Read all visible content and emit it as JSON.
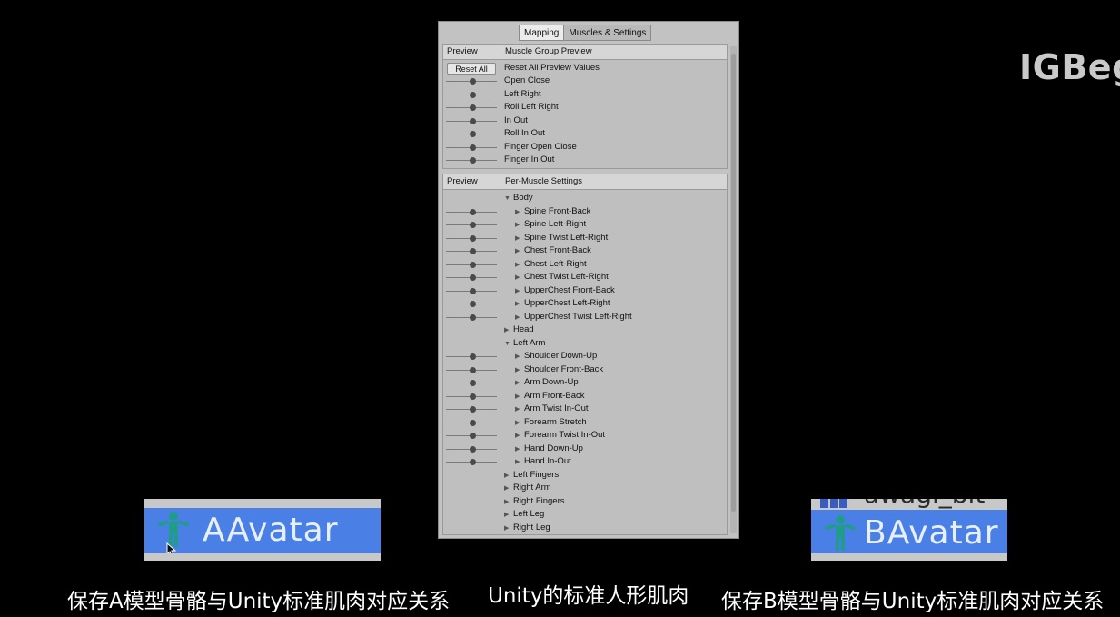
{
  "watermark": "IGBeg",
  "tabs": {
    "mapping": "Mapping",
    "muscles": "Muscles & Settings"
  },
  "muscle_group": {
    "col_preview": "Preview",
    "col_title": "Muscle Group Preview",
    "reset_button": "Reset All",
    "reset_label": "Reset All Preview Values",
    "items": [
      "Open Close",
      "Left Right",
      "Roll Left Right",
      "In Out",
      "Roll In Out",
      "Finger Open Close",
      "Finger In Out"
    ]
  },
  "per_muscle": {
    "col_preview": "Preview",
    "col_title": "Per-Muscle Settings",
    "rows": [
      {
        "label": "Body",
        "level": 0,
        "expanded": true,
        "slider": false
      },
      {
        "label": "Spine Front-Back",
        "level": 1,
        "expanded": false,
        "slider": true
      },
      {
        "label": "Spine Left-Right",
        "level": 1,
        "expanded": false,
        "slider": true
      },
      {
        "label": "Spine Twist Left-Right",
        "level": 1,
        "expanded": false,
        "slider": true
      },
      {
        "label": "Chest Front-Back",
        "level": 1,
        "expanded": false,
        "slider": true
      },
      {
        "label": "Chest Left-Right",
        "level": 1,
        "expanded": false,
        "slider": true
      },
      {
        "label": "Chest Twist Left-Right",
        "level": 1,
        "expanded": false,
        "slider": true
      },
      {
        "label": "UpperChest Front-Back",
        "level": 1,
        "expanded": false,
        "slider": true
      },
      {
        "label": "UpperChest Left-Right",
        "level": 1,
        "expanded": false,
        "slider": true
      },
      {
        "label": "UpperChest Twist Left-Right",
        "level": 1,
        "expanded": false,
        "slider": true
      },
      {
        "label": "Head",
        "level": 0,
        "expanded": false,
        "slider": false
      },
      {
        "label": "Left Arm",
        "level": 0,
        "expanded": true,
        "slider": false
      },
      {
        "label": "Shoulder Down-Up",
        "level": 1,
        "expanded": false,
        "slider": true
      },
      {
        "label": "Shoulder Front-Back",
        "level": 1,
        "expanded": false,
        "slider": true
      },
      {
        "label": "Arm Down-Up",
        "level": 1,
        "expanded": false,
        "slider": true
      },
      {
        "label": "Arm Front-Back",
        "level": 1,
        "expanded": false,
        "slider": true
      },
      {
        "label": "Arm Twist In-Out",
        "level": 1,
        "expanded": false,
        "slider": true
      },
      {
        "label": "Forearm Stretch",
        "level": 1,
        "expanded": false,
        "slider": true
      },
      {
        "label": "Forearm Twist In-Out",
        "level": 1,
        "expanded": false,
        "slider": true
      },
      {
        "label": "Hand Down-Up",
        "level": 1,
        "expanded": false,
        "slider": true
      },
      {
        "label": "Hand In-Out",
        "level": 1,
        "expanded": false,
        "slider": true
      },
      {
        "label": "Left Fingers",
        "level": 0,
        "expanded": false,
        "slider": false
      },
      {
        "label": "Right Arm",
        "level": 0,
        "expanded": false,
        "slider": false
      },
      {
        "label": "Right Fingers",
        "level": 0,
        "expanded": false,
        "slider": false
      },
      {
        "label": "Left Leg",
        "level": 0,
        "expanded": false,
        "slider": false
      },
      {
        "label": "Right Leg",
        "level": 0,
        "expanded": false,
        "slider": false
      }
    ]
  },
  "avatar_a": {
    "name": "AAvatar"
  },
  "avatar_b": {
    "name": "BAvatar",
    "partial_above": "awagi_bit"
  },
  "captions": {
    "left": "保存A模型骨骼与Unity标准肌肉对应关系",
    "center": "Unity的标准人形肌肉",
    "right": "保存B模型骨骼与Unity标准肌肉对应关系"
  },
  "colors": {
    "avatar_bg": "#4a80e6",
    "panel_bg": "#c2c2c2",
    "icon": "#1f9c8a"
  }
}
